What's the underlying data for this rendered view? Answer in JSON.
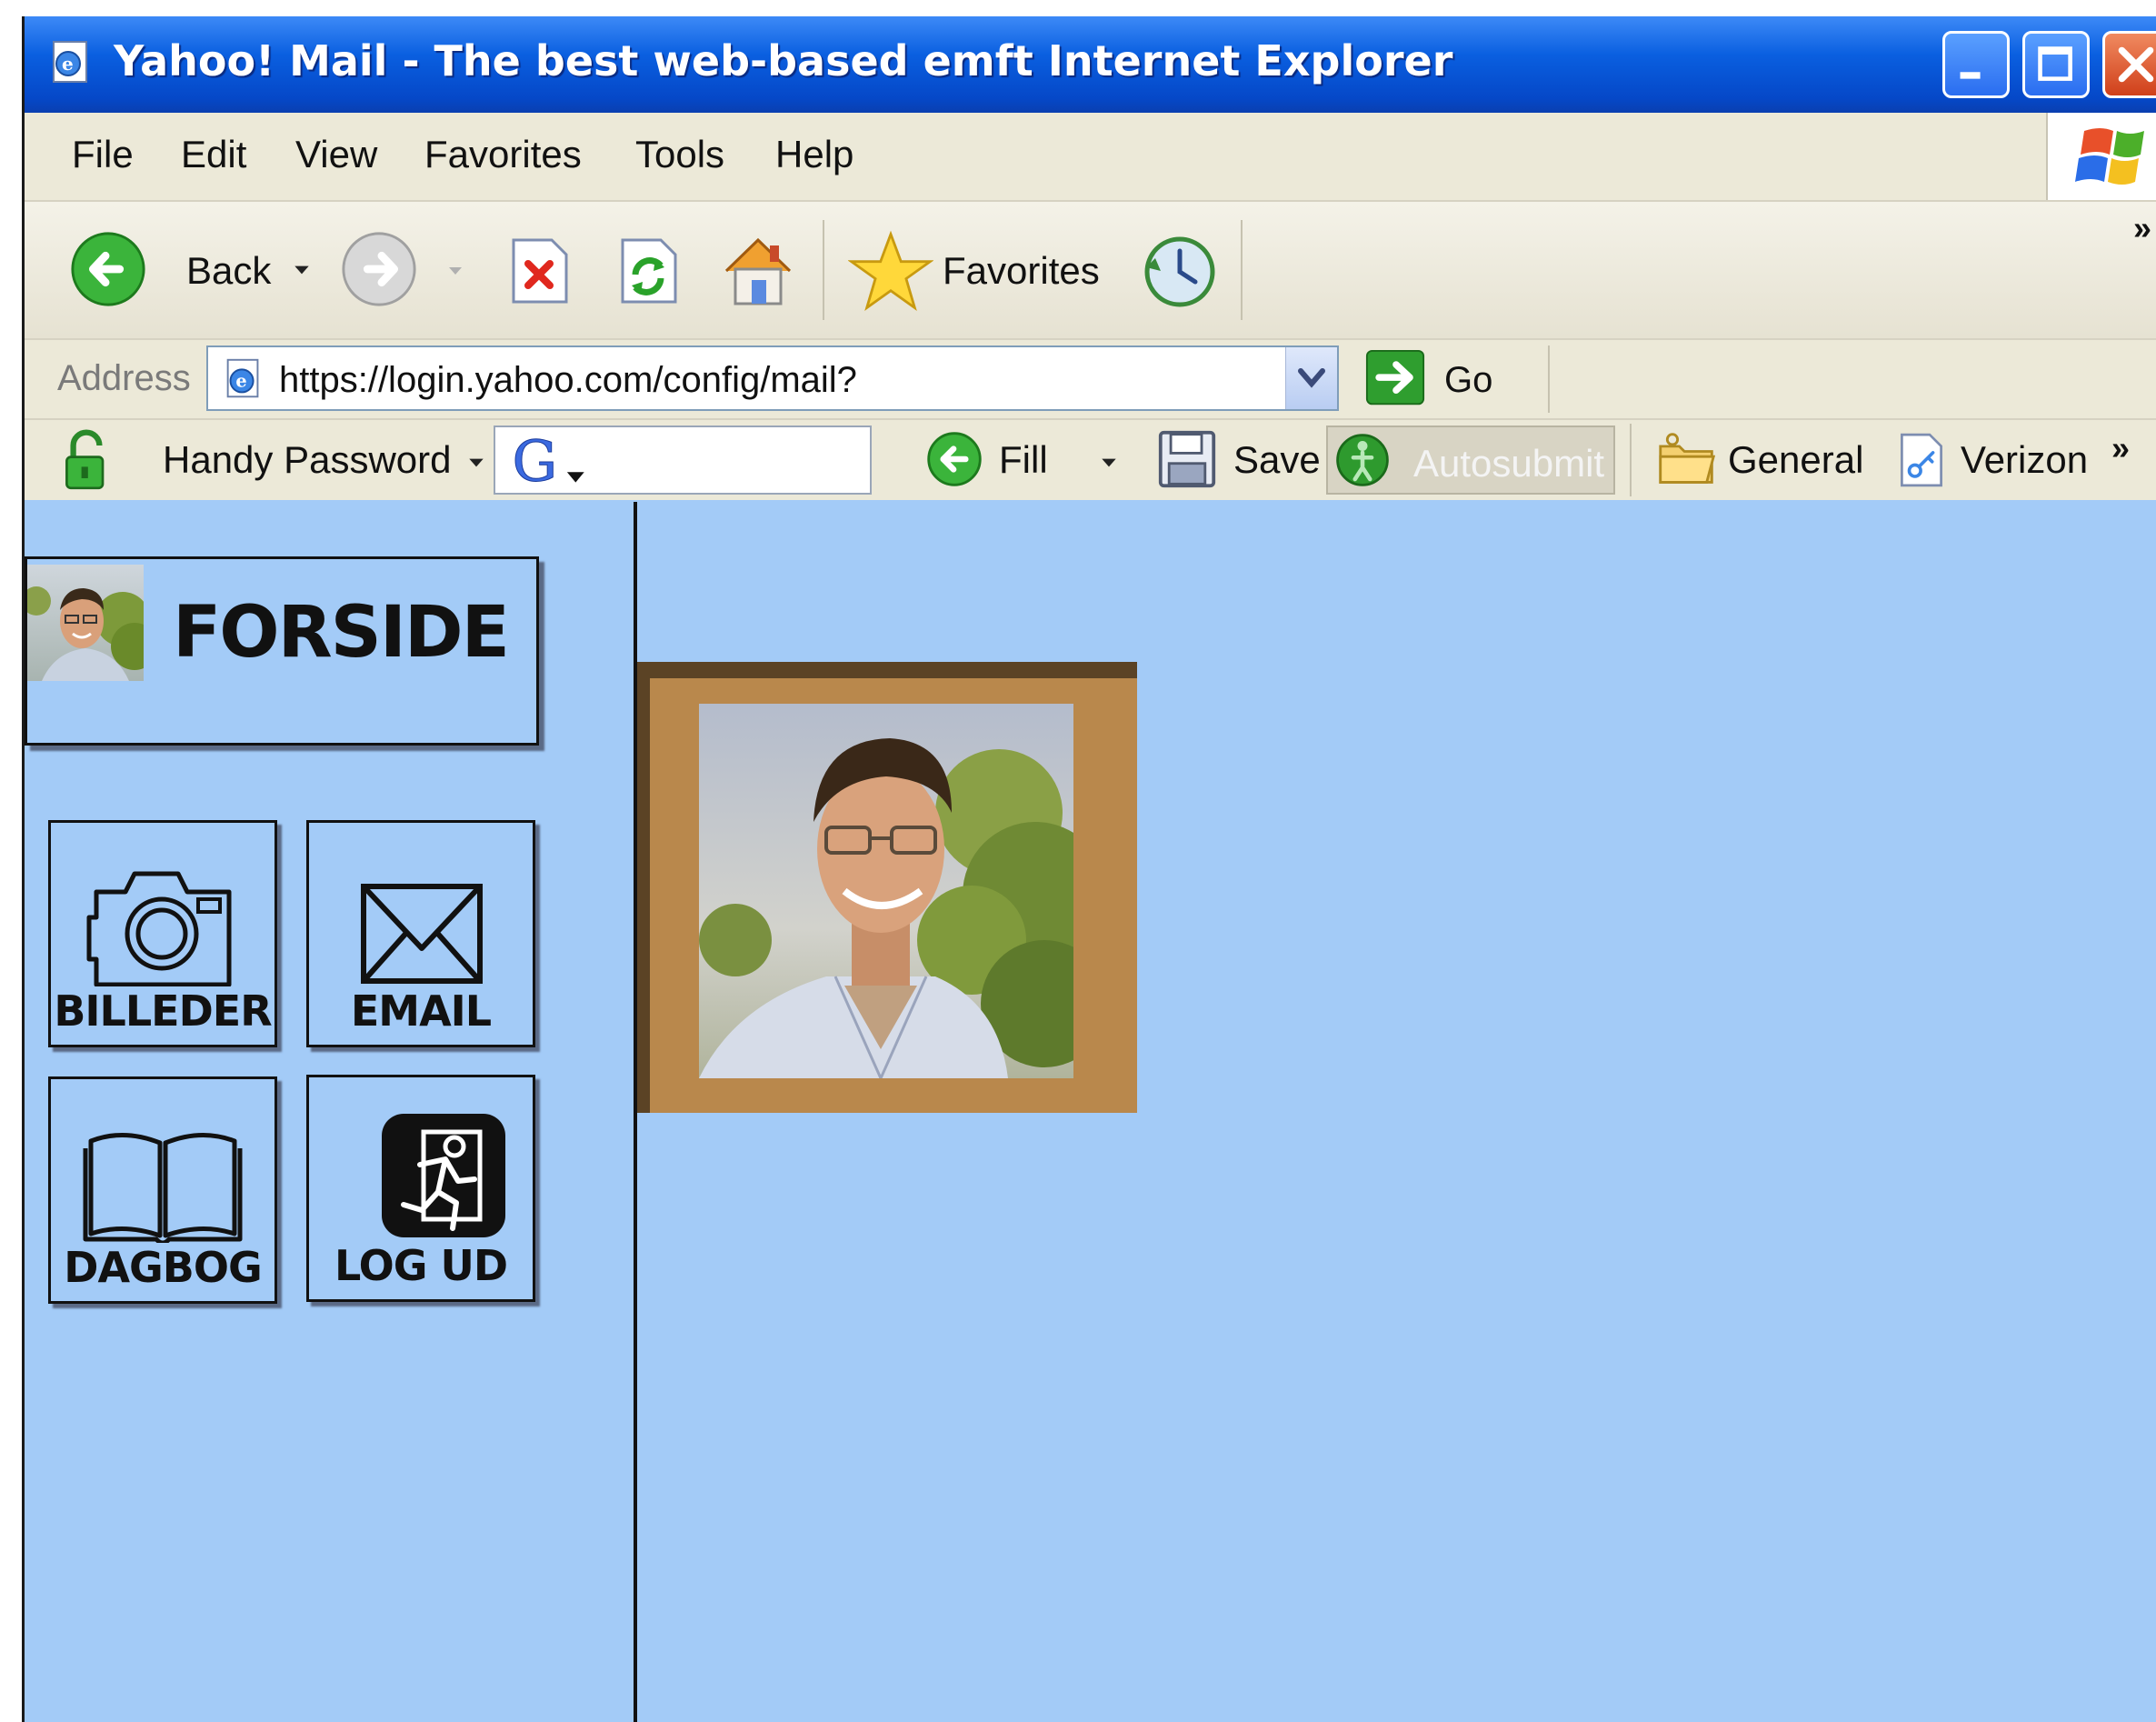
{
  "window": {
    "title": "Yahoo! Mail - The best web-based emft Internet Explorer"
  },
  "menubar": {
    "items": [
      "File",
      "Edit",
      "View",
      "Favorites",
      "Tools",
      "Help"
    ]
  },
  "toolbar": {
    "back_label": "Back",
    "favorites_label": "Favorites",
    "more": "»"
  },
  "addressbar": {
    "label": "Address",
    "url": "https://login.yahoo.com/config/mail?",
    "go_label": "Go"
  },
  "passwordbar": {
    "handy_password_label": "Handy Password",
    "fill_label": "Fill",
    "save_label": "Save",
    "autosubmit_label": "Autosubmit",
    "general_label": "General",
    "verizon_label": "Verizon",
    "more": "»"
  },
  "page": {
    "forside_label": "FORSIDE",
    "nav": {
      "pictures": "BILLEDER",
      "email": "EMAIL",
      "diary": "DAGBOG",
      "logout": "LOG UD"
    }
  },
  "icons": {
    "app": "ie-page-icon",
    "back": "back-arrow-icon",
    "forward": "forward-arrow-icon",
    "stop": "stop-icon",
    "refresh": "refresh-icon",
    "home": "home-icon",
    "favorites": "star-icon",
    "history": "history-icon",
    "go": "go-arrow-icon",
    "lock": "lock-icon",
    "camera": "camera-icon",
    "envelope": "envelope-icon",
    "book": "book-icon",
    "exit": "exit-icon"
  },
  "colors": {
    "page_background": "#a3cbf7",
    "titlebar": "#0a5fe0",
    "frame": "#b9884c",
    "frame_shadow": "#5b4325"
  }
}
